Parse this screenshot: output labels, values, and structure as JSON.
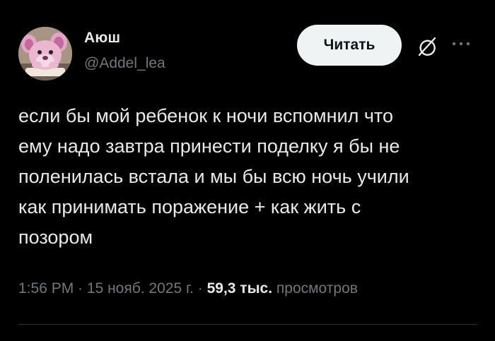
{
  "author": {
    "display_name": "Аюш",
    "handle": "@Addel_lea",
    "avatar_icon": "pink-bear-avatar"
  },
  "actions": {
    "follow_label": "Читать",
    "grok_icon": "grok-icon",
    "more_icon": "more-icon"
  },
  "tweet": {
    "text": "если бы мой ребенок к ночи вспомнил что\nему надо завтра принести поделку я бы не\nполенилась встала и мы бы всю ночь учили\nкак принимать поражение + как жить с\nпозором"
  },
  "meta": {
    "time": "1:56 PM",
    "separator": " · ",
    "date": "15 нояб. 2025 г.",
    "views_count": "59,3 тыс.",
    "views_label": "просмотров"
  },
  "colors": {
    "background": "#000000",
    "text_primary": "#e7e9ea",
    "text_secondary": "#71767b",
    "button_bg": "#eff3f4",
    "divider": "#2f3336"
  }
}
